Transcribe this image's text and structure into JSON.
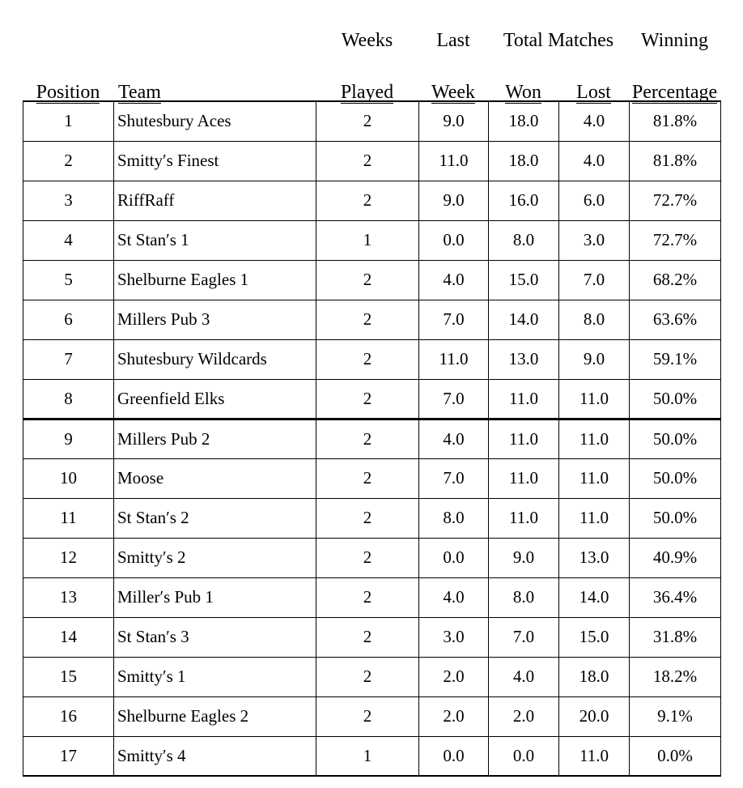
{
  "header": {
    "line1": {
      "position": "",
      "team": "",
      "weeks_played": "Weeks",
      "last_week": "Last",
      "total_matches": "Total Matches",
      "winning_percentage": "Winning"
    },
    "line2": {
      "position": "Position",
      "team": "Team",
      "weeks_played": "Played",
      "last_week": "Week",
      "won": "Won",
      "lost": "Lost",
      "winning_percentage": "Percentage"
    }
  },
  "table_data": {
    "type": "table",
    "columns": [
      "Position",
      "Team",
      "Weeks Played",
      "Last Week",
      "Total Matches Won",
      "Total Matches Lost",
      "Winning Percentage"
    ],
    "divider_after_row": 8,
    "rows": [
      {
        "position": "1",
        "team": "Shutesbury Aces",
        "weeks_played": "2",
        "last_week": "9.0",
        "won": "18.0",
        "lost": "4.0",
        "pct": "81.8%"
      },
      {
        "position": "2",
        "team": "Smittyʹs Finest",
        "weeks_played": "2",
        "last_week": "11.0",
        "won": "18.0",
        "lost": "4.0",
        "pct": "81.8%"
      },
      {
        "position": "3",
        "team": "RiffRaff",
        "weeks_played": "2",
        "last_week": "9.0",
        "won": "16.0",
        "lost": "6.0",
        "pct": "72.7%"
      },
      {
        "position": "4",
        "team": "St Stanʹs 1",
        "weeks_played": "1",
        "last_week": "0.0",
        "won": "8.0",
        "lost": "3.0",
        "pct": "72.7%"
      },
      {
        "position": "5",
        "team": "Shelburne Eagles 1",
        "weeks_played": "2",
        "last_week": "4.0",
        "won": "15.0",
        "lost": "7.0",
        "pct": "68.2%"
      },
      {
        "position": "6",
        "team": "Millers Pub 3",
        "weeks_played": "2",
        "last_week": "7.0",
        "won": "14.0",
        "lost": "8.0",
        "pct": "63.6%"
      },
      {
        "position": "7",
        "team": "Shutesbury Wildcards",
        "weeks_played": "2",
        "last_week": "11.0",
        "won": "13.0",
        "lost": "9.0",
        "pct": "59.1%"
      },
      {
        "position": "8",
        "team": "Greenfield Elks",
        "weeks_played": "2",
        "last_week": "7.0",
        "won": "11.0",
        "lost": "11.0",
        "pct": "50.0%"
      },
      {
        "position": "9",
        "team": "Millers Pub 2",
        "weeks_played": "2",
        "last_week": "4.0",
        "won": "11.0",
        "lost": "11.0",
        "pct": "50.0%"
      },
      {
        "position": "10",
        "team": "Moose",
        "weeks_played": "2",
        "last_week": "7.0",
        "won": "11.0",
        "lost": "11.0",
        "pct": "50.0%"
      },
      {
        "position": "11",
        "team": "St Stanʹs 2",
        "weeks_played": "2",
        "last_week": "8.0",
        "won": "11.0",
        "lost": "11.0",
        "pct": "50.0%"
      },
      {
        "position": "12",
        "team": "Smittyʹs 2",
        "weeks_played": "2",
        "last_week": "0.0",
        "won": "9.0",
        "lost": "13.0",
        "pct": "40.9%"
      },
      {
        "position": "13",
        "team": "Millerʹs Pub 1",
        "weeks_played": "2",
        "last_week": "4.0",
        "won": "8.0",
        "lost": "14.0",
        "pct": "36.4%"
      },
      {
        "position": "14",
        "team": "St Stanʹs 3",
        "weeks_played": "2",
        "last_week": "3.0",
        "won": "7.0",
        "lost": "15.0",
        "pct": "31.8%"
      },
      {
        "position": "15",
        "team": "Smittyʹs 1",
        "weeks_played": "2",
        "last_week": "2.0",
        "won": "4.0",
        "lost": "18.0",
        "pct": "18.2%"
      },
      {
        "position": "16",
        "team": "Shelburne Eagles 2",
        "weeks_played": "2",
        "last_week": "2.0",
        "won": "2.0",
        "lost": "20.0",
        "pct": "9.1%"
      },
      {
        "position": "17",
        "team": "Smittyʹs 4",
        "weeks_played": "1",
        "last_week": "0.0",
        "won": "0.0",
        "lost": "11.0",
        "pct": "0.0%"
      }
    ]
  }
}
